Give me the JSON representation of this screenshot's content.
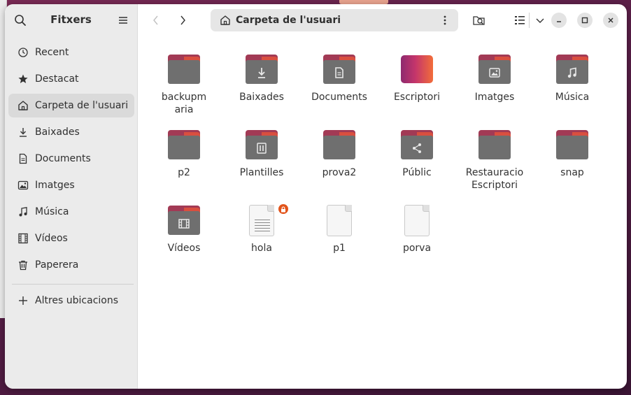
{
  "app_title": "Fitxers",
  "pathbar": {
    "current_location": "Carpeta de l'usuari"
  },
  "sidebar": {
    "items": [
      {
        "label": "Recent",
        "icon": "clock-icon"
      },
      {
        "label": "Destacat",
        "icon": "star-icon"
      },
      {
        "label": "Carpeta de l'usuari",
        "icon": "home-icon",
        "active": true
      },
      {
        "label": "Baixades",
        "icon": "download-icon"
      },
      {
        "label": "Documents",
        "icon": "document-icon"
      },
      {
        "label": "Imatges",
        "icon": "image-icon"
      },
      {
        "label": "Música",
        "icon": "music-icon"
      },
      {
        "label": "Vídeos",
        "icon": "film-icon"
      },
      {
        "label": "Paperera",
        "icon": "trash-icon"
      }
    ],
    "other_locations": {
      "label": "Altres ubicacions",
      "icon": "plus-icon"
    }
  },
  "files": [
    {
      "name": "backupmaria",
      "type": "folder",
      "glyph": ""
    },
    {
      "name": "Baixades",
      "type": "folder",
      "glyph": "download"
    },
    {
      "name": "Documents",
      "type": "folder",
      "glyph": "document"
    },
    {
      "name": "Escriptori",
      "type": "desktop",
      "glyph": ""
    },
    {
      "name": "Imatges",
      "type": "folder",
      "glyph": "image"
    },
    {
      "name": "Música",
      "type": "folder",
      "glyph": "music"
    },
    {
      "name": "p2",
      "type": "folder",
      "glyph": ""
    },
    {
      "name": "Plantilles",
      "type": "folder",
      "glyph": "template"
    },
    {
      "name": "prova2",
      "type": "folder",
      "glyph": ""
    },
    {
      "name": "Públic",
      "type": "folder",
      "glyph": "share"
    },
    {
      "name": "Restauracio Escriptori",
      "type": "folder",
      "glyph": ""
    },
    {
      "name": "snap",
      "type": "folder",
      "glyph": ""
    },
    {
      "name": "Vídeos",
      "type": "folder",
      "glyph": "film"
    },
    {
      "name": "hola",
      "type": "text",
      "glyph": "",
      "locked": true
    },
    {
      "name": "p1",
      "type": "blank",
      "glyph": ""
    },
    {
      "name": "porva",
      "type": "blank",
      "glyph": ""
    }
  ],
  "colors": {
    "folder_tab": "#a23a55",
    "folder_accent": "#d94f3f",
    "folder_body": "#6f6f6f",
    "lock_badge": "#e2541b"
  }
}
